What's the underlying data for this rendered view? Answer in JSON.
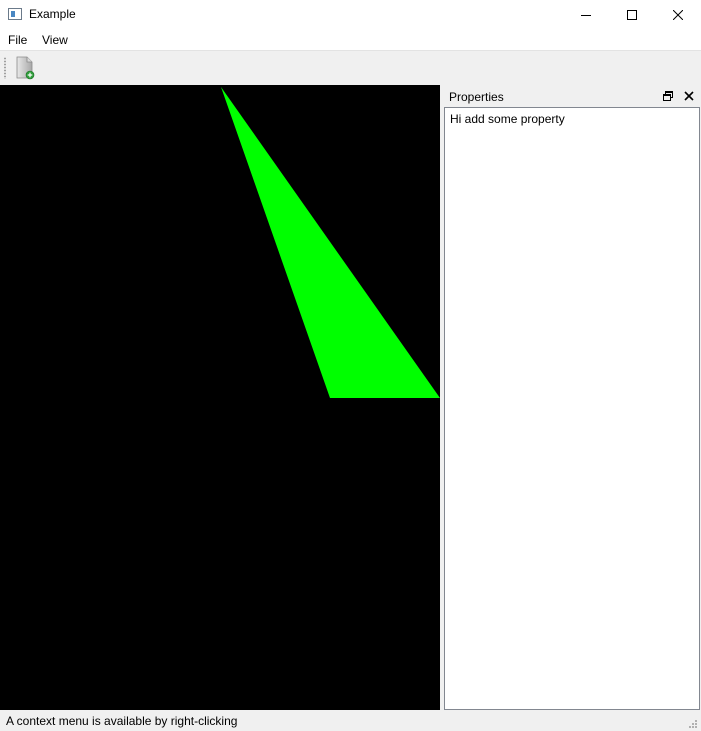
{
  "window": {
    "title": "Example"
  },
  "menu": {
    "file": "File",
    "view": "View"
  },
  "toolbar": {
    "new_icon": "new-document-icon"
  },
  "canvas": {
    "background": "#000000",
    "shape_color": "#00ff00"
  },
  "dock": {
    "title": "Properties",
    "content": "Hi add some property"
  },
  "status": {
    "message": "A context menu is available by right-clicking"
  }
}
